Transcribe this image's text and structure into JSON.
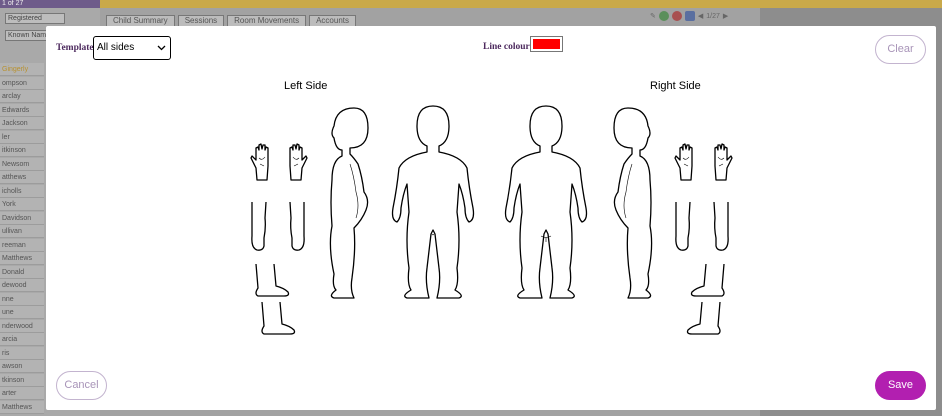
{
  "background": {
    "pager": "1 of 27",
    "filter_select": "Registered",
    "name_select": "Known Name",
    "names": [
      "Gingerly",
      "ompson",
      "arclay",
      "Edwards",
      "Jackson",
      "ler",
      "itkinson",
      "Newsom",
      "atthews",
      "icholls",
      "York",
      "Davidson",
      "ullivan",
      "reeman",
      "Matthews",
      "Donald",
      "dewood",
      "nne",
      "une",
      "nderwood",
      "arcia",
      "ris",
      "awson",
      "tkinson",
      "arter",
      "Matthews"
    ],
    "tabs": [
      "Child Summary",
      "Sessions",
      "Room Movements",
      "Accounts"
    ],
    "page_counter": "1/27"
  },
  "modal": {
    "template_label": "Template",
    "template_value": "All sides",
    "line_colour_label": "Line colour",
    "line_colour": "#ff0000",
    "left_side_label": "Left Side",
    "right_side_label": "Right Side",
    "clear_label": "Clear",
    "cancel_label": "Cancel",
    "save_label": "Save",
    "accent_color": "#b21fb0"
  }
}
